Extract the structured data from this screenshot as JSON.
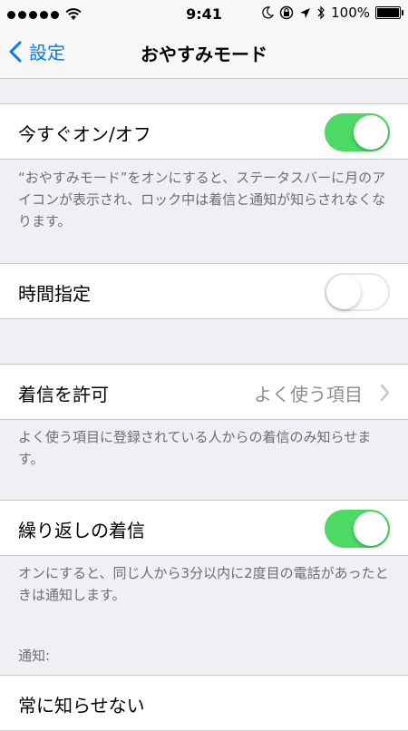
{
  "status_bar": {
    "time": "9:41",
    "battery": "100%",
    "battery_level": 1.0
  },
  "nav": {
    "back_label": "設定",
    "title": "おやすみモード"
  },
  "rows": {
    "manual": {
      "label": "今すぐオン/オフ",
      "on": true
    },
    "scheduled": {
      "label": "時間指定",
      "on": false
    },
    "allow_calls": {
      "label": "着信を許可",
      "value": "よく使う項目"
    },
    "repeated_calls": {
      "label": "繰り返しの着信",
      "on": true
    },
    "silence": {
      "label": "常に知らせない"
    }
  },
  "footers": {
    "manual": "“おやすみモード”をオンにすると、ステータスバーに月のアイコンが表示され、ロック中は着信と通知が知らされなくなります。",
    "allow_calls": "よく使う項目に登録されている人からの着信のみ知らせます。",
    "repeated_calls": "オンにすると、同じ人から3分以内に2度目の電話があったときは通知します。"
  },
  "section_headers": {
    "silence": "通知:"
  },
  "colors": {
    "accent": "#007aff",
    "toggle_on": "#4cd964",
    "background": "#efeff4"
  }
}
